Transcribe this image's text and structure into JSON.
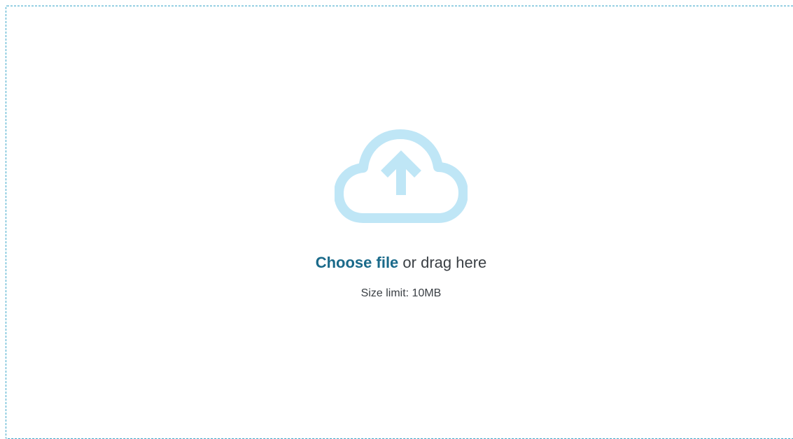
{
  "uploader": {
    "icon": "cloud-upload-icon",
    "choose_label": "Choose file",
    "drag_text": " or drag here",
    "size_limit_text": "Size limit: 10MB"
  },
  "colors": {
    "border": "#3aa6c9",
    "icon": "#bfe6f6",
    "link": "#1a6a8a",
    "text": "#3a3f44"
  }
}
